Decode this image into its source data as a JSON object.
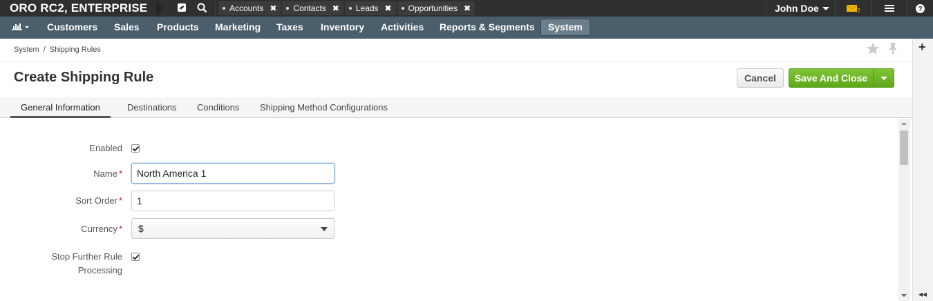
{
  "app": {
    "brand": "ORO RC2, ENTERPRISE"
  },
  "topbar": {
    "tabs": [
      {
        "label": "Accounts"
      },
      {
        "label": "Contacts"
      },
      {
        "label": "Leads"
      },
      {
        "label": "Opportunities"
      }
    ],
    "user_name": "John Doe",
    "mail_count": "2",
    "colors": {
      "bar": "#2f2f2f",
      "mail": "#f0b400"
    }
  },
  "nav": {
    "items": [
      {
        "label": "Customers"
      },
      {
        "label": "Sales"
      },
      {
        "label": "Products"
      },
      {
        "label": "Marketing"
      },
      {
        "label": "Taxes"
      },
      {
        "label": "Inventory"
      },
      {
        "label": "Activities"
      },
      {
        "label": "Reports & Segments"
      },
      {
        "label": "System"
      }
    ],
    "active": "System",
    "colors": {
      "bar": "#4b5e6c"
    }
  },
  "breadcrumb": {
    "parts": [
      "System",
      "Shipping Rules"
    ],
    "separator": "/"
  },
  "page": {
    "title": "Create Shipping Rule"
  },
  "actions": {
    "cancel_label": "Cancel",
    "save_label": "Save And Close",
    "save_color": "#6cb52a"
  },
  "tabs": [
    {
      "label": "General Information"
    },
    {
      "label": "Destinations"
    },
    {
      "label": "Conditions"
    },
    {
      "label": "Shipping Method Configurations"
    }
  ],
  "active_tab": "General Information",
  "form": {
    "enabled": {
      "label": "Enabled",
      "checked": true
    },
    "name": {
      "label": "Name",
      "value": "North America 1",
      "required": "*"
    },
    "sort_order": {
      "label": "Sort Order",
      "value": "1",
      "required": "*"
    },
    "currency": {
      "label": "Currency",
      "value": "$",
      "required": "*"
    },
    "stop_processing": {
      "label_line1": "Stop Further Rule",
      "label_line2": "Processing",
      "checked": true
    }
  }
}
